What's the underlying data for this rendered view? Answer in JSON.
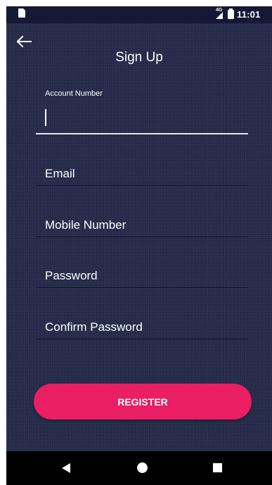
{
  "status_bar": {
    "network": "4G",
    "time": "11:01",
    "icons": [
      "sd-card-icon",
      "signal-icon",
      "battery-icon"
    ]
  },
  "header": {
    "back_icon": "arrow-left-icon",
    "title": "Sign Up"
  },
  "form": {
    "account_number": {
      "label": "Account Number",
      "value": ""
    },
    "email": {
      "placeholder": "Email",
      "value": ""
    },
    "mobile_number": {
      "placeholder": "Mobile Number",
      "value": ""
    },
    "password": {
      "placeholder": "Password",
      "value": ""
    },
    "confirm_password": {
      "placeholder": "Confirm Password",
      "value": ""
    }
  },
  "register_label": "REGISTER",
  "nav_bar": {
    "icons": [
      "back-triangle-icon",
      "home-circle-icon",
      "recents-square-icon"
    ]
  },
  "colors": {
    "background": "#252a4a",
    "status_bar": "#151935",
    "accent": "#ea1f63",
    "text": "#ffffff",
    "nav_bar": "#000000"
  }
}
